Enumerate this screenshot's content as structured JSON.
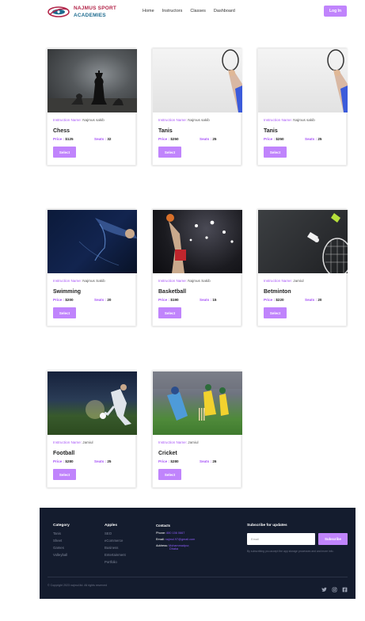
{
  "header": {
    "brand_line1": "NAJMUS SPORT",
    "brand_line2": "ACADEMIES",
    "nav": [
      "Home",
      "Instructors",
      "Classes",
      "Dashboard"
    ],
    "login_label": "Log In",
    "accent": "#c084fc"
  },
  "classes": [
    {
      "image": "chess-king-icon",
      "instructor_label": "Instruction Name:",
      "instructor": "Najmus sakib",
      "title": "Chess",
      "price_label": "Price :",
      "price": "$125",
      "seats_label": "Seats :",
      "seats": "32",
      "button": "Select"
    },
    {
      "image": "tennis-racket-icon",
      "instructor_label": "Instruction Name:",
      "instructor": "Najmus sakib",
      "title": "Tanis",
      "price_label": "Price :",
      "price": "$250",
      "seats_label": "Seats :",
      "seats": "25",
      "button": "Select"
    },
    {
      "image": "tennis-racket-icon",
      "instructor_label": "Instruction Name:",
      "instructor": "Najmus sakib",
      "title": "Tanis",
      "price_label": "Price :",
      "price": "$250",
      "seats_label": "Seats :",
      "seats": "25",
      "button": "Select"
    },
    {
      "image": "swimmer-icon",
      "instructor_label": "Instruction Name:",
      "instructor": "Najmus Sakib",
      "title": "Swimming",
      "price_label": "Price :",
      "price": "$200",
      "seats_label": "Seats :",
      "seats": "20",
      "button": "Select"
    },
    {
      "image": "basketball-player-icon",
      "instructor_label": "Instruction Name:",
      "instructor": "Najmus Sakib",
      "title": "Basketball",
      "price_label": "Price :",
      "price": "$190",
      "seats_label": "Seats :",
      "seats": "15",
      "button": "Select"
    },
    {
      "image": "badminton-shuttle-icon",
      "instructor_label": "Instruction Name:",
      "instructor": "Jamiul",
      "title": "Betminton",
      "price_label": "Price :",
      "price": "$220",
      "seats_label": "Seats :",
      "seats": "20",
      "button": "Select"
    },
    {
      "image": "football-player-icon",
      "instructor_label": "Instruction Name:",
      "instructor": "Jamiul",
      "title": "Football",
      "price_label": "Price :",
      "price": "$280",
      "seats_label": "Seats :",
      "seats": "25",
      "button": "Select"
    },
    {
      "image": "cricket-batsman-icon",
      "instructor_label": "Instruction Name:",
      "instructor": "Jamiul",
      "title": "Cricket",
      "price_label": "Price :",
      "price": "$280",
      "seats_label": "Seats :",
      "seats": "26",
      "button": "Select"
    }
  ],
  "footer": {
    "category": {
      "heading": "Category",
      "items": [
        "Tanis",
        "Sheet",
        "Games",
        "Volleyball"
      ]
    },
    "apples": {
      "heading": "Apples",
      "items": [
        "SEO",
        "eCommerce",
        "Business",
        "Entertainment",
        "Portfolio"
      ]
    },
    "contacts": {
      "heading": "Contacts",
      "phone_label": "Phone:",
      "phone": "880 156 0667",
      "email_label": "Email:",
      "email": "najmul.97@gmail.com",
      "address_label": "Address:",
      "address_line1": "Mohammadpur,",
      "address_line2": "Dhaka"
    },
    "subscribe": {
      "heading": "Subscribe for updates",
      "placeholder": "Email",
      "button": "Subscribe",
      "note": "By subscribing you accept the app storage processes and and more info."
    },
    "copyright": "© Copyright 2023 najmul.ltd. All rights reserved",
    "social": [
      "twitter-icon",
      "instagram-icon",
      "facebook-icon"
    ],
    "bg_color": "#141c2e"
  }
}
